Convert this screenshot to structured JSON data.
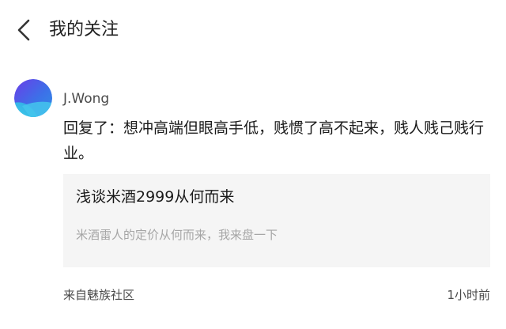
{
  "header": {
    "back_icon": "chevron-left-icon",
    "title": "我的关注"
  },
  "post": {
    "avatar_icon": "gradient-avatar-icon",
    "avatar_colors": [
      "#6a3de8",
      "#2f8fe6",
      "#3ed1e8"
    ],
    "username": "J.Wong",
    "comment": "回复了：想冲高端但眼高手低，贱惯了高不起来，贱人贱己贱行业。",
    "card": {
      "title": "浅谈米酒2999从何而来",
      "description": "米酒雷人的定价从何而来，我来盘一下"
    },
    "source": "来自魅族社区",
    "time": "1小时前"
  }
}
